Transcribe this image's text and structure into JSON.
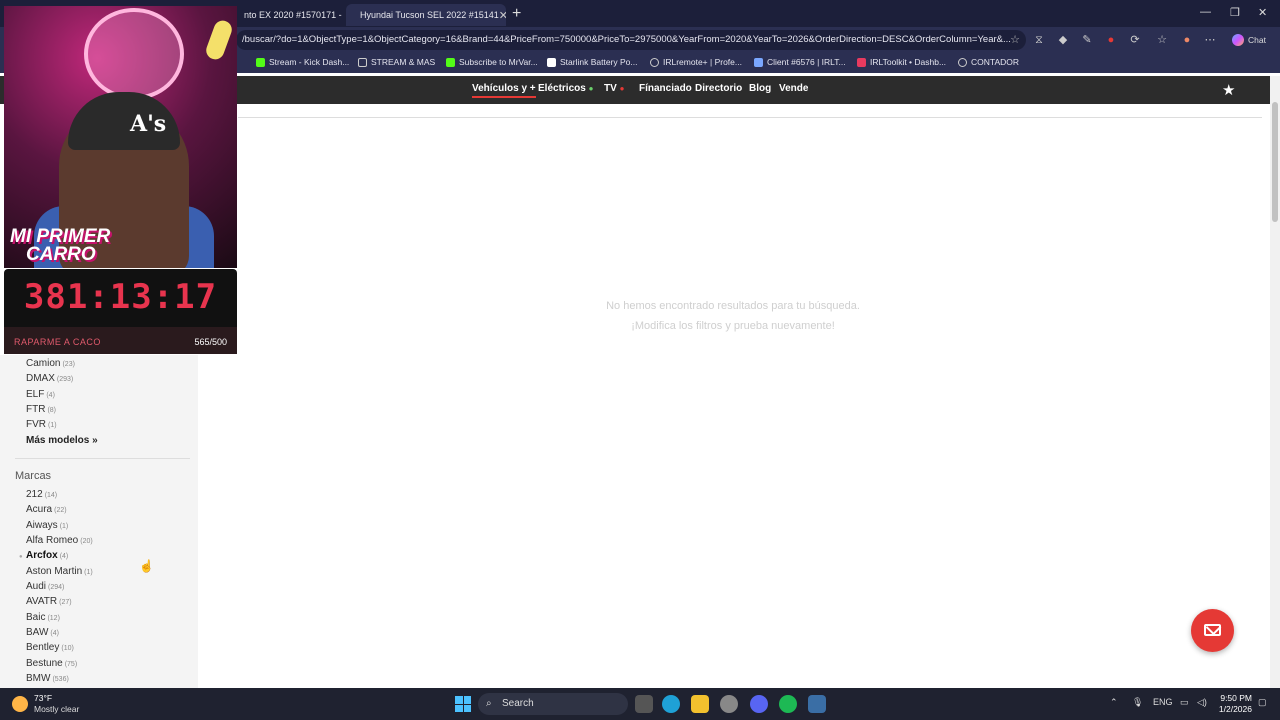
{
  "browser": {
    "tabs": [
      {
        "title": "nto EX 2020 #1570171 - S"
      },
      {
        "title": "Hyundai Tucson SEL 2022 #15141"
      }
    ],
    "url": "/buscar/?do=1&ObjectType=1&ObjectCategory=16&Brand=44&PriceFrom=750000&PriceTo=2975000&YearFrom=2020&YearTo=2026&OrderDirection=DESC&OrderColumn=Year&...",
    "chat_label": "Chat",
    "bookmarks": [
      {
        "label": "Stream - Kick Dash...",
        "color": "#53fc18"
      },
      {
        "label": "STREAM & MAS",
        "color": "#cccccc"
      },
      {
        "label": "Subscribe to MrVar...",
        "color": "#53fc18"
      },
      {
        "label": "Starlink Battery Po...",
        "color": "#ffffff"
      },
      {
        "label": "IRLremote+ | Profe...",
        "color": "#cccccc"
      },
      {
        "label": "Client #6576 | IRLT...",
        "color": "#7aa7ff"
      },
      {
        "label": "IRLToolkit • Dashb...",
        "color": "#e83a5f"
      },
      {
        "label": "CONTADOR",
        "color": "#cccccc"
      }
    ]
  },
  "site_nav": {
    "items": [
      {
        "label": "Vehículos y +"
      },
      {
        "label": "Eléctricos"
      },
      {
        "label": "TV"
      },
      {
        "label": "Fínanciado"
      },
      {
        "label": "Directorio"
      },
      {
        "label": "Blog"
      },
      {
        "label": "Vende"
      }
    ],
    "electric_icon": "leaf-icon",
    "tv_icon": "live-dot-icon"
  },
  "results": {
    "empty_line1": "No hemos encontrado resultados para tu búsqueda.",
    "empty_line2": "¡Modifica los filtros y prueba nuevamente!"
  },
  "sidebar": {
    "models": [
      {
        "name": "Camion",
        "count": "(23)"
      },
      {
        "name": "DMAX",
        "count": "(293)"
      },
      {
        "name": "ELF",
        "count": "(4)"
      },
      {
        "name": "FTR",
        "count": "(8)"
      },
      {
        "name": "FVR",
        "count": "(1)"
      }
    ],
    "more_models": "Más modelos »",
    "brands_heading": "Marcas",
    "brands": [
      {
        "name": "212",
        "count": "(14)"
      },
      {
        "name": "Acura",
        "count": "(22)"
      },
      {
        "name": "Aiways",
        "count": "(1)"
      },
      {
        "name": "Alfa Romeo",
        "count": "(20)"
      },
      {
        "name": "Arcfox",
        "count": "(4)"
      },
      {
        "name": "Aston Martin",
        "count": "(1)"
      },
      {
        "name": "Audi",
        "count": "(294)"
      },
      {
        "name": "AVATR",
        "count": "(27)"
      },
      {
        "name": "Baic",
        "count": "(12)"
      },
      {
        "name": "BAW",
        "count": "(4)"
      },
      {
        "name": "Bentley",
        "count": "(10)"
      },
      {
        "name": "Bestune",
        "count": "(75)"
      },
      {
        "name": "BMW",
        "count": "(536)"
      }
    ]
  },
  "overlay": {
    "logo_line1": "MI PRIMER",
    "logo_line2": "CARRO",
    "timer": "381:13:17",
    "label": "RAPARME A CACO",
    "count": "565/500",
    "accent": "#e8344e"
  },
  "taskbar": {
    "temp": "73°F",
    "weather": "Mostly clear",
    "search_label": "Search",
    "lang": "ENG",
    "time": "9:50 PM",
    "date": "1/2/2026"
  }
}
